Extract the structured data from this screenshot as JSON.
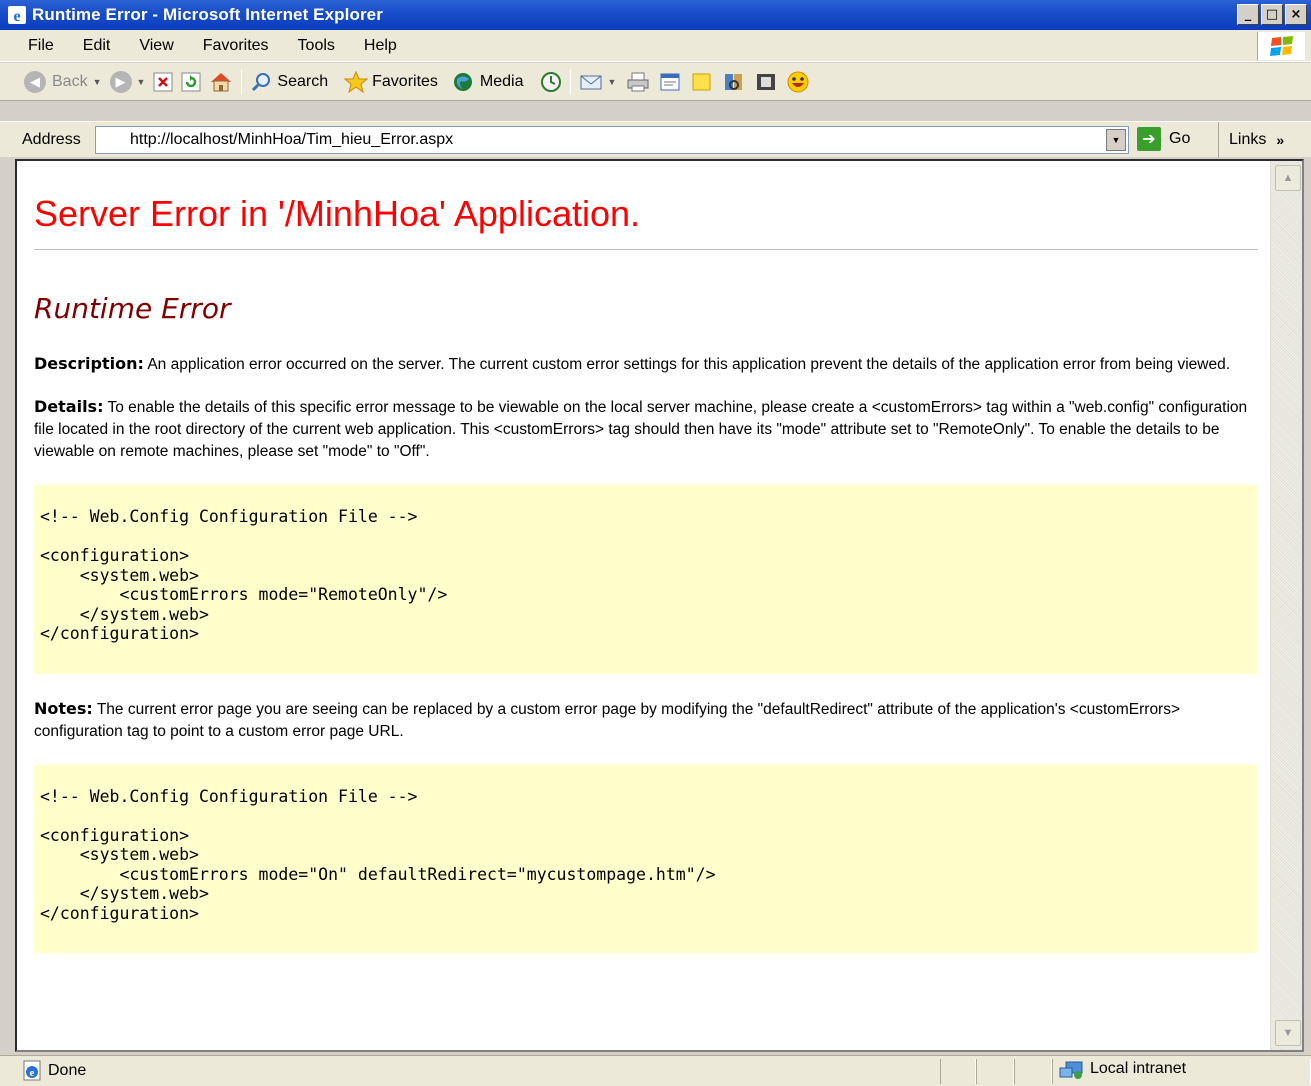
{
  "window": {
    "title": "Runtime Error - Microsoft Internet Explorer",
    "controls": [
      "_",
      "□",
      "×"
    ]
  },
  "menu": [
    "File",
    "Edit",
    "View",
    "Favorites",
    "Tools",
    "Help"
  ],
  "toolbar": {
    "back_label": "Back",
    "search_label": "Search",
    "favorites_label": "Favorites",
    "media_label": "Media"
  },
  "address": {
    "label": "Address",
    "url": "http://localhost/MinhHoa/Tim_hieu_Error.aspx",
    "go_label": "Go",
    "links_label": "Links"
  },
  "page": {
    "heading": "Server Error in '/MinhHoa' Application.",
    "subheading": "Runtime Error",
    "description_label": "Description:",
    "description_text": " An application error occurred on the server. The current custom error settings for this application prevent the details of the application error from being viewed.",
    "details_label": "Details:",
    "details_text": " To enable the details of this specific error message to be viewable on the local server machine, please create a <customErrors> tag within a \"web.config\" configuration file located in the root directory of the current web application. This <customErrors> tag should then have its \"mode\" attribute set to \"RemoteOnly\". To enable the details to be viewable on remote machines, please set \"mode\" to \"Off\".",
    "code1": {
      "comment": "<!-- Web.Config Configuration File -->",
      "line1": "<configuration>",
      "line2": "    <system.web>",
      "line3": "        <customErrors mode=\"RemoteOnly\"/>",
      "line4": "    </system.web>",
      "line5": "</configuration>"
    },
    "notes_label": "Notes:",
    "notes_text": " The current error page you are seeing can be replaced by a custom error page by modifying the \"defaultRedirect\" attribute of the application's <customErrors> configuration tag to point to a custom error page URL.",
    "code2": {
      "comment": "<!-- Web.Config Configuration File -->",
      "line1": "<configuration>",
      "line2": "    <system.web>",
      "line3": "        <customErrors mode=\"On\" defaultRedirect=\"mycustompage.htm\"/>",
      "line4": "    </system.web>",
      "line5": "</configuration>"
    }
  },
  "status": {
    "text": "Done",
    "zone": "Local intranet"
  },
  "colors": {
    "heading": "#ff0000",
    "subheading": "#800000",
    "code_background": "#ffffcc",
    "titlebar": "#0b3dbd"
  }
}
